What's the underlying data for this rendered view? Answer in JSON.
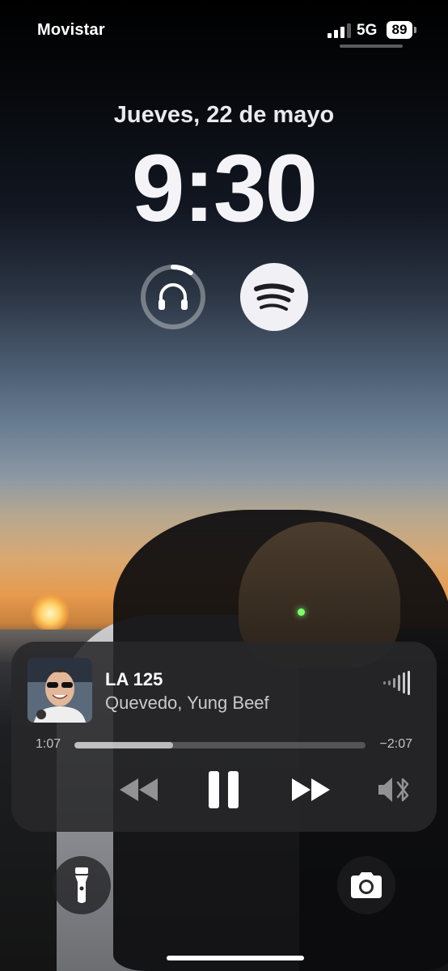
{
  "status_bar": {
    "carrier": "Movistar",
    "network": "5G",
    "battery": "89",
    "signal_bars_active": 3,
    "signal_bars_total": 4
  },
  "lock_screen": {
    "date": "Jueves, 22 de mayo",
    "time": "9:30"
  },
  "widgets": [
    {
      "icon": "headphones-battery-icon",
      "battery_fraction": 0.1
    },
    {
      "icon": "spotify-icon"
    }
  ],
  "now_playing": {
    "title": "LA 125",
    "artist": "Quevedo, Yung Beef",
    "elapsed": "1:07",
    "remaining": "−2:07",
    "progress_fraction": 0.34,
    "controls": [
      "rewind-icon",
      "pause-icon",
      "fast-forward-icon",
      "audio-output-bluetooth-icon"
    ]
  },
  "quick_actions": [
    "flashlight-icon",
    "camera-icon"
  ],
  "colors": {
    "spotify_widget_bg": "#f1f1f5",
    "player_bg": "#28282a"
  }
}
